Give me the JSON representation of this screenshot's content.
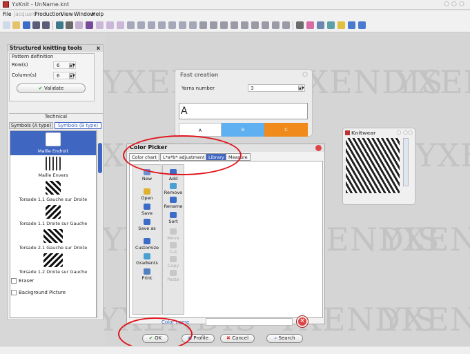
{
  "window": {
    "title": "YxKnit - UnName.knt",
    "controls": [
      "○",
      "○",
      "○"
    ]
  },
  "menu": [
    {
      "label": "File",
      "enabled": true
    },
    {
      "label": "Jacquard",
      "enabled": false
    },
    {
      "label": "Production",
      "enabled": true
    },
    {
      "label": "View",
      "enabled": true
    },
    {
      "label": "Window",
      "enabled": true
    },
    {
      "label": "Help",
      "enabled": true
    }
  ],
  "tools_panel": {
    "title": "Structured knitting tools",
    "close": "x",
    "pattern_definition": {
      "legend": "Pattern definition",
      "rows_label": "Row(s)",
      "rows_value": "6",
      "columns_label": "Column(s)",
      "columns_value": "6",
      "validate": "Validate"
    },
    "technical_label": "Technical",
    "tabs": [
      {
        "label": "Symbols (A type)",
        "active": false
      },
      {
        "label": "Symbols (B type)",
        "active": true
      }
    ],
    "symbols": [
      {
        "label": "Maille Endroit",
        "selected": true
      },
      {
        "label": "Maille Envers",
        "selected": false
      },
      {
        "label": "Torsade 1.1 Gauche sur Droite",
        "selected": false
      },
      {
        "label": "Torsade 1.1 Droite sur Gauche",
        "selected": false
      },
      {
        "label": "Torsade 2.1 Gauche sur Droite",
        "selected": false
      },
      {
        "label": "Torsade 1.2 Droite sur Gauche",
        "selected": false
      }
    ],
    "eraser": "Eraser",
    "background_picture": "Background Picture"
  },
  "fast_creation": {
    "title": "Fast creation",
    "yarns_label": "Yarns number",
    "yarns_value": "3",
    "preview_text": "A",
    "colors": [
      {
        "label": "A",
        "color": "#ffffff"
      },
      {
        "label": "B",
        "color": "#5fb0f0"
      },
      {
        "label": "C",
        "color": "#f08a1a"
      }
    ]
  },
  "knitwear": {
    "title": "Knitwear"
  },
  "color_picker": {
    "title": "Color Picker",
    "tabs": [
      {
        "label": "Color chart",
        "active": false
      },
      {
        "label": "L*a*b* adjustment",
        "active": false
      },
      {
        "label": "Library",
        "active": true
      },
      {
        "label": "Measure",
        "active": false
      }
    ],
    "left_actions": [
      {
        "label": "New",
        "icon": "new-icon",
        "color": "#6b8fd0"
      },
      {
        "label": "Open",
        "icon": "open-folder-icon",
        "color": "#e0b030"
      },
      {
        "label": "Save",
        "icon": "save-icon",
        "color": "#3b6cc8"
      },
      {
        "label": "Save as",
        "icon": "save-as-icon",
        "color": "#3b6cc8"
      },
      {
        "label": "Customize",
        "icon": "customize-icon",
        "color": "#3b6cc8"
      },
      {
        "label": "Gradients",
        "icon": "gradients-icon",
        "color": "#4aa0d0"
      },
      {
        "label": "Print",
        "icon": "print-icon",
        "color": "#5080c0"
      }
    ],
    "right_actions": [
      {
        "label": "Add",
        "icon": "add-icon",
        "enabled": true,
        "color": "#3b6cc8"
      },
      {
        "label": "Remove",
        "icon": "remove-icon",
        "enabled": true,
        "color": "#4aa0d0"
      },
      {
        "label": "Rename",
        "icon": "rename-icon",
        "enabled": true,
        "color": "#3b6cc8"
      },
      {
        "label": "Sort",
        "icon": "sort-icon",
        "enabled": true,
        "color": "#3b6cc8"
      },
      {
        "label": "Move",
        "icon": "move-icon",
        "enabled": false,
        "color": "#c8c8c8"
      },
      {
        "label": "Cut",
        "icon": "cut-icon",
        "enabled": false,
        "color": "#c8c8c8"
      },
      {
        "label": "Copy",
        "icon": "copy-icon",
        "enabled": false,
        "color": "#c8c8c8"
      },
      {
        "label": "Paste",
        "icon": "paste-icon",
        "enabled": false,
        "color": "#c8c8c8"
      }
    ],
    "color_name_label": "Color name",
    "color_name_value": "",
    "buttons": {
      "ok": "OK",
      "profile": "Profile",
      "cancel": "Cancel",
      "search": "Search"
    }
  },
  "watermark": "YXENDIS",
  "colors": {
    "accent": "#3f66c0",
    "annotation": "#e0141c"
  }
}
